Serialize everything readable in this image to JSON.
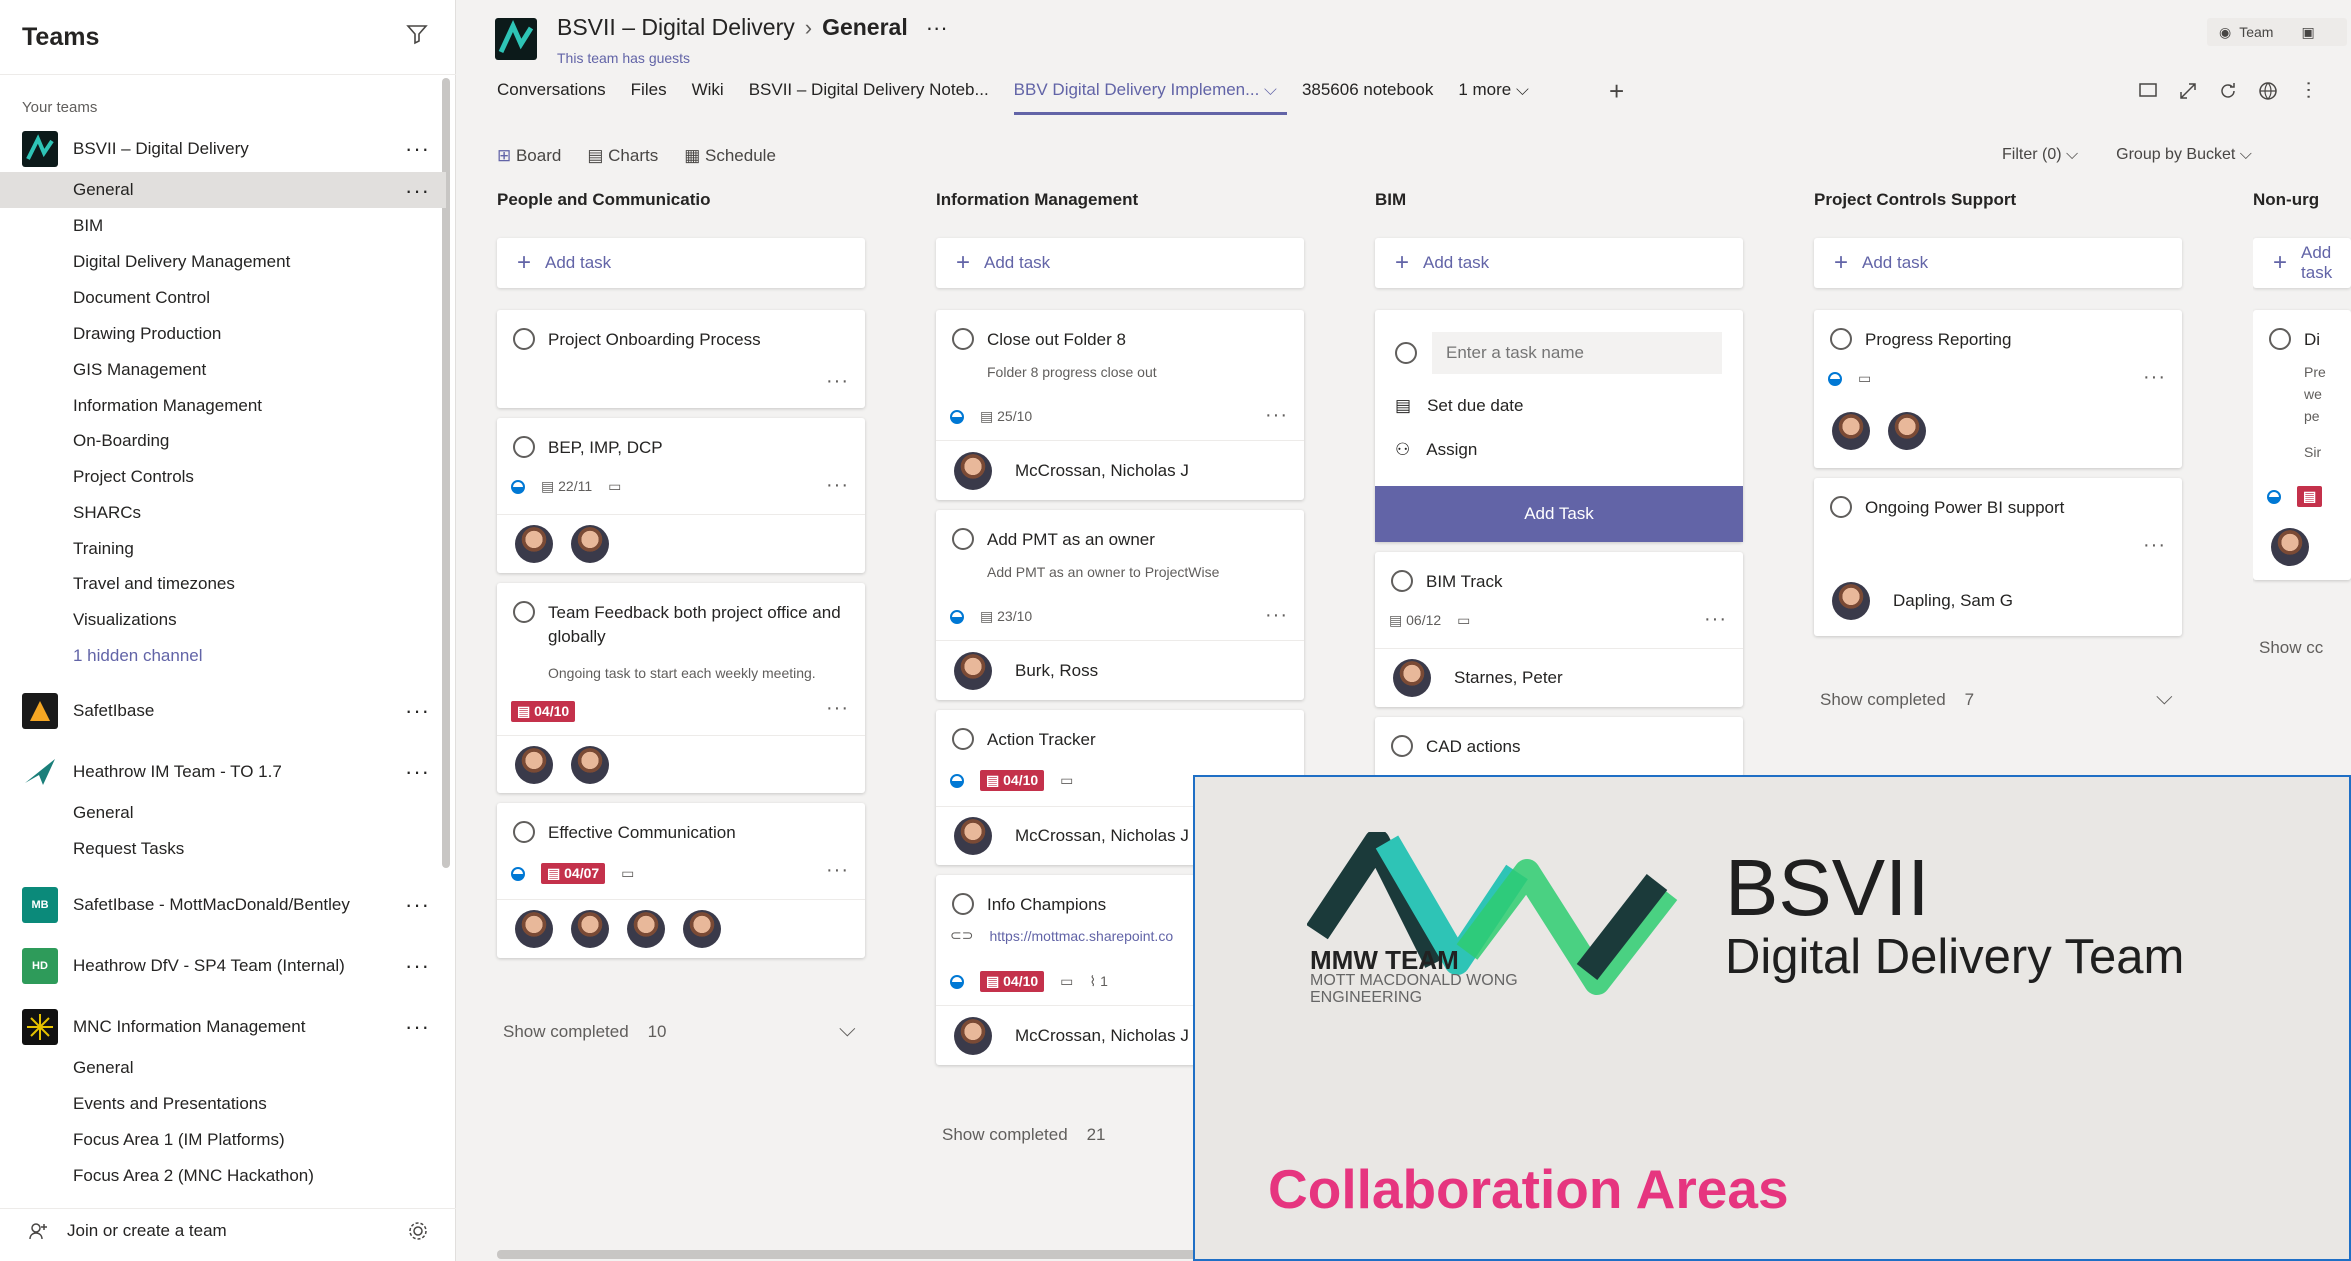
{
  "sidebar": {
    "title": "Teams",
    "your_teams_label": "Your teams",
    "teams": [
      {
        "name": "BSVII – Digital Delivery",
        "logo": "bsvii-logo",
        "channels": [
          "General",
          "BIM",
          "Digital Delivery Management",
          "Document Control",
          "Drawing Production",
          "GIS Management",
          "Information Management",
          "On-Boarding",
          "Project Controls",
          "SHARCs",
          "Training",
          "Travel and timezones",
          "Visualizations"
        ],
        "hidden": "1 hidden channel"
      },
      {
        "name": "SafetIbase",
        "logo": "safetibase-logo"
      },
      {
        "name": "Heathrow IM Team - TO 1.7",
        "logo": "heathrow-logo",
        "channels": [
          "General",
          "Request Tasks"
        ]
      },
      {
        "name": "SafetIbase - MottMacDonald/Bentley",
        "logo_text": "MB",
        "logo_color": "#0b8a7a"
      },
      {
        "name": "Heathrow DfV - SP4 Team (Internal)",
        "logo_text": "HD",
        "logo_color": "#2e9b5a"
      },
      {
        "name": "MNC Information Management",
        "logo": "mnc-logo",
        "channels": [
          "General",
          "Events and Presentations",
          "Focus Area 1 (IM Platforms)",
          "Focus Area 2 (MNC Hackathon)"
        ]
      }
    ],
    "join": "Join or create a team"
  },
  "header": {
    "team": "BSVII – Digital Delivery",
    "channel": "General",
    "guests": "This team has guests",
    "team_btn": "Team",
    "tabs": [
      "Conversations",
      "Files",
      "Wiki",
      "BSVII – Digital Delivery Noteb...",
      "BBV Digital Delivery Implemen...",
      "385606 notebook",
      "1 more"
    ],
    "active_tab": 4
  },
  "planner": {
    "views": [
      "Board",
      "Charts",
      "Schedule"
    ],
    "filter": "Filter (0)",
    "group": "Group by Bucket",
    "add_task": "Add task",
    "buckets": [
      {
        "name": "People and Communicatio",
        "show": "Show completed",
        "count": "10"
      },
      {
        "name": "Information Management",
        "show": "Show completed",
        "count": "21"
      },
      {
        "name": "BIM"
      },
      {
        "name": "Project Controls Support",
        "show": "Show completed",
        "count": "7"
      },
      {
        "name": "Non-urg"
      }
    ],
    "cards": {
      "c1": {
        "title": "Project Onboarding Process"
      },
      "c2": {
        "title": "BEP, IMP, DCP",
        "date": "22/11"
      },
      "c3": {
        "title": "Team Feedback both project office and globally",
        "note": "Ongoing task to start each weekly meeting.",
        "due": "04/10"
      },
      "c4": {
        "title": "Effective Communication",
        "due": "04/07"
      },
      "c5": {
        "title": "Close out Folder 8",
        "note": "Folder 8 progress close out",
        "date": "25/10",
        "assignee": "McCrossan, Nicholas J"
      },
      "c6": {
        "title": "Add PMT as an owner",
        "note": "Add PMT as an owner to ProjectWise",
        "date": "23/10",
        "assignee": "Burk, Ross"
      },
      "c7": {
        "title": "Action Tracker",
        "due": "04/10",
        "assignee": "McCrossan, Nicholas J"
      },
      "c8": {
        "title": "Info Champions",
        "link": "https://mottmac.sharepoint.co",
        "due": "04/10",
        "attach": "1",
        "assignee": "McCrossan, Nicholas J"
      },
      "c9": {
        "placeholder": "Enter a task name",
        "set_due": "Set due date",
        "assign": "Assign",
        "add_btn": "Add Task"
      },
      "c10": {
        "title": "BIM Track",
        "date": "06/12",
        "assignee": "Starnes, Peter"
      },
      "c11": {
        "title": "CAD actions"
      },
      "c12": {
        "title": "Progress Reporting"
      },
      "c13": {
        "title": "Ongoing Power BI support",
        "assignee": "Dapling, Sam G"
      },
      "c14": {
        "title": "Di",
        "n1": "Pre",
        "n2": "we",
        "n3": "pe",
        "n4": "Sir"
      },
      "show5": "Show cc"
    }
  },
  "overlay": {
    "logo_main": "MMW TEAM",
    "logo_sub": "MOTT MACDONALD WONG ENGINEERING",
    "title": "BSVII",
    "subtitle": "Digital Delivery Team",
    "collab": "Collaboration Areas",
    "accent": "#e6357f"
  }
}
